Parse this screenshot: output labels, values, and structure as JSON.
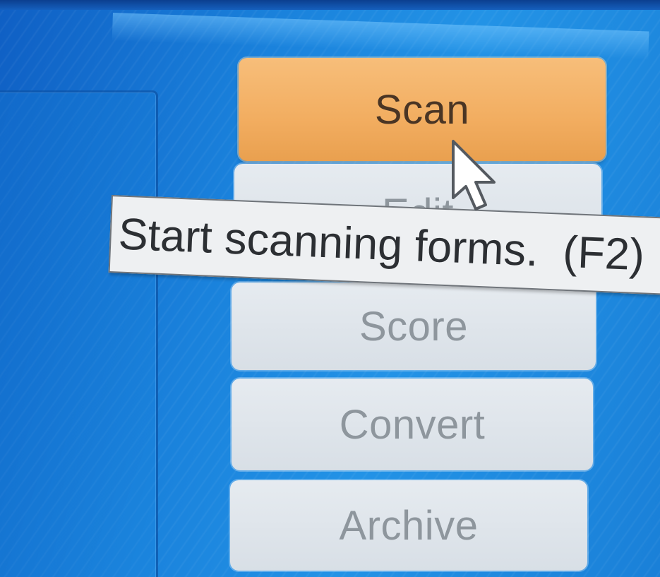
{
  "toolbar": {
    "scan_label": "Scan",
    "edit_label": "Edit",
    "score_label": "Score",
    "convert_label": "Convert",
    "archive_label": "Archive"
  },
  "tooltip": {
    "text": "Start scanning forms.  (F2)"
  },
  "colors": {
    "background": "#1a82dc",
    "scan_button": "#f2ad60",
    "plain_button": "#dde3e9",
    "tooltip_bg": "#eef0f2"
  },
  "icons": {
    "cursor": "mouse-pointer-icon"
  }
}
